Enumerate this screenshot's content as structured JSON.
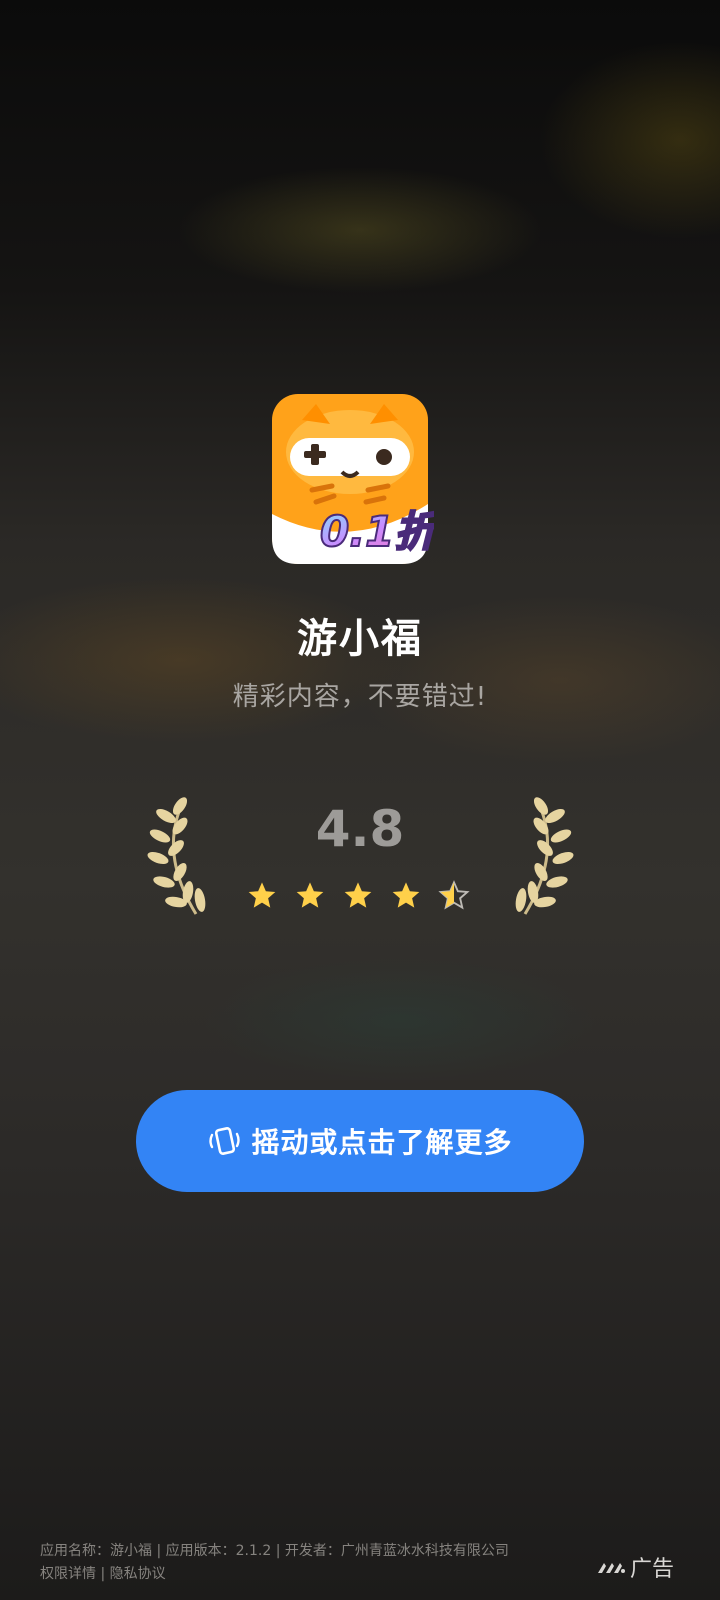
{
  "app": {
    "name": "游小福",
    "tagline": "精彩内容，不要错过!",
    "icon_badge_text": "0.1折"
  },
  "rating": {
    "value": "4.8",
    "stars_filled": 4.5,
    "stars_total": 5
  },
  "cta": {
    "label": "摇动或点击了解更多",
    "icon": "shake-phone-icon"
  },
  "footer": {
    "line1_app_name": "应用名称：游小福",
    "line1_version": "应用版本：2.1.2",
    "line1_developer": "开发者：广州青蓝冰水科技有限公司",
    "separator": "|",
    "permissions_link": "权限详情",
    "privacy_link": "隐私协议"
  },
  "ad_badge": {
    "label": "广告",
    "icon": "ad-network-logo-icon"
  },
  "colors": {
    "cta_background": "#3384f5",
    "star_fill": "#ffd04a",
    "icon_orange": "#ffa21a",
    "laurel_gold": "#e6d4a0"
  }
}
